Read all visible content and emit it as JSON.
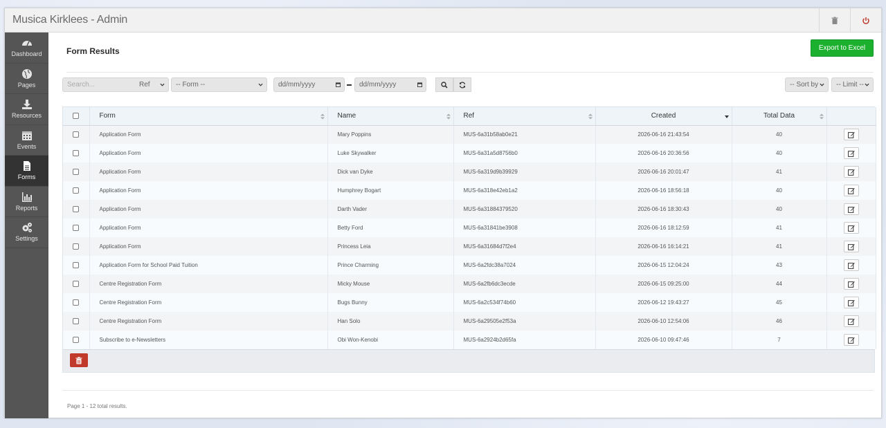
{
  "app": {
    "title": "Musica Kirklees - Admin"
  },
  "topbar": {
    "trash_icon": "trash-icon",
    "power_icon": "power-icon"
  },
  "sidebar": {
    "items": [
      {
        "label": "Dashboard",
        "icon": "dashboard-icon",
        "active": false
      },
      {
        "label": "Pages",
        "icon": "globe-icon",
        "active": false
      },
      {
        "label": "Resources",
        "icon": "download-icon",
        "active": false
      },
      {
        "label": "Events",
        "icon": "calendar-icon",
        "active": false
      },
      {
        "label": "Forms",
        "icon": "file-icon",
        "active": true
      },
      {
        "label": "Reports",
        "icon": "bar-chart-icon",
        "active": false
      },
      {
        "label": "Settings",
        "icon": "cogs-icon",
        "active": false
      }
    ]
  },
  "main": {
    "title": "Form Results",
    "export_label": "Export to Excel",
    "filters": {
      "search_placeholder": "Search...",
      "ref_label": "Ref",
      "form_label": "-- Form --",
      "date_from": "dd/mm/yyyy",
      "date_to": "dd/mm/yyyy",
      "sort_label": "-- Sort by",
      "limit_label": "-- Limit --"
    },
    "table": {
      "headers": [
        "Form",
        "Name",
        "Ref",
        "Created",
        "Total Data"
      ],
      "rows": [
        [
          "Application Form",
          "Mary Poppins",
          "MUS-6a31b58ab0e21",
          "2026-06-16 21:43:54",
          "40"
        ],
        [
          "Application Form",
          "Luke Skywalker",
          "MUS-6a31a5d8756b0",
          "2026-06-16 20:36:56",
          "40"
        ],
        [
          "Application Form",
          "Dick van Dyke",
          "MUS-6a319d9b39929",
          "2026-06-16 20:01:47",
          "41"
        ],
        [
          "Application Form",
          "Humphrey Bogart",
          "MUS-6a318e42eb1a2",
          "2026-06-16 18:56:18",
          "40"
        ],
        [
          "Application Form",
          "Darth Vader",
          "MUS-6a31884379520",
          "2026-06-16 18:30:43",
          "40"
        ],
        [
          "Application Form",
          "Betty Ford",
          "MUS-6a31841be3908",
          "2026-06-16 18:12:59",
          "41"
        ],
        [
          "Application Form",
          "Princess Leia",
          "MUS-6a31684d7f2e4",
          "2026-06-16 16:14:21",
          "41"
        ],
        [
          "Application Form for School Paid Tuition",
          "Prince Charming",
          "MUS-6a2fdc38a7024",
          "2026-06-15 12:04:24",
          "43"
        ],
        [
          "Centre Registration Form",
          "Micky Mouse",
          "MUS-6a2fb6dc3ecde",
          "2026-06-15 09:25:00",
          "44"
        ],
        [
          "Centre Registration Form",
          "Bugs Bunny",
          "MUS-6a2c534f74b60",
          "2026-06-12 19:43:27",
          "45"
        ],
        [
          "Centre Registration Form",
          "Han Solo",
          "MUS-6a29505e2f53a",
          "2026-06-10 12:54:06",
          "46"
        ],
        [
          "Subscribe to e-Newsletters",
          "Obi Won-Kenobi",
          "MUS-6a2924b2d65fa",
          "2026-06-10 09:47:46",
          "7"
        ]
      ]
    },
    "pagination": "Page 1 - 12 total results."
  },
  "colors": {
    "export": "#1bb02d",
    "delete": "#c0392b",
    "sidebar": "#555555",
    "sidebar_active": "#333333"
  }
}
